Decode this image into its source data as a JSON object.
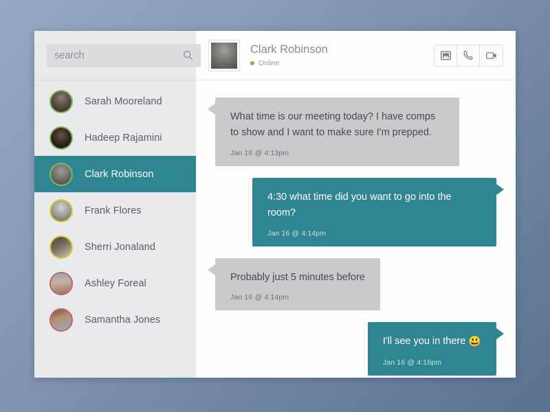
{
  "search": {
    "placeholder": "search",
    "value": "",
    "icon": "search-icon"
  },
  "contacts": [
    {
      "name": "Sarah Mooreland",
      "status": "online",
      "selected": false
    },
    {
      "name": "Hadeep Rajamini",
      "status": "online",
      "selected": false
    },
    {
      "name": "Clark Robinson",
      "status": "online",
      "selected": true
    },
    {
      "name": "Frank Flores",
      "status": "away",
      "selected": false
    },
    {
      "name": "Sherri Jonaland",
      "status": "away",
      "selected": false
    },
    {
      "name": "Ashley Foreal",
      "status": "busy",
      "selected": false
    },
    {
      "name": "Samantha Jones",
      "status": "busy",
      "selected": false
    }
  ],
  "header": {
    "name": "Clark Robinson",
    "status": "Online",
    "status_color": "#7dba4f",
    "avatar": "contact-avatar",
    "actions": [
      {
        "icon": "image-icon",
        "label": "Send image"
      },
      {
        "icon": "phone-icon",
        "label": "Voice call"
      },
      {
        "icon": "video-icon",
        "label": "Video call"
      }
    ]
  },
  "messages": [
    {
      "direction": "in",
      "text": "What time is our meeting today? I have comps to show and I want to make sure I'm prepped.",
      "timestamp": "Jan 16 @ 4:13pm"
    },
    {
      "direction": "out",
      "text": "4:30 what time did you want to go into the room?",
      "timestamp": "Jan 16 @ 4:14pm"
    },
    {
      "direction": "in",
      "text": "Probably just 5 minutes before",
      "timestamp": "Jan 16 @ 4:14pm"
    },
    {
      "direction": "out",
      "text": "I'll see you in there ",
      "emoji": "😃",
      "timestamp": "Jan 16 @ 4:16pm"
    }
  ],
  "colors": {
    "accent_teal": "#2f8591",
    "sidebar_bg": "#e9eaec",
    "bubble_gray": "#c9cacb",
    "online_ring": "#7dba4f",
    "away_ring": "#d8cf2e",
    "busy_ring": "#c2606a"
  }
}
